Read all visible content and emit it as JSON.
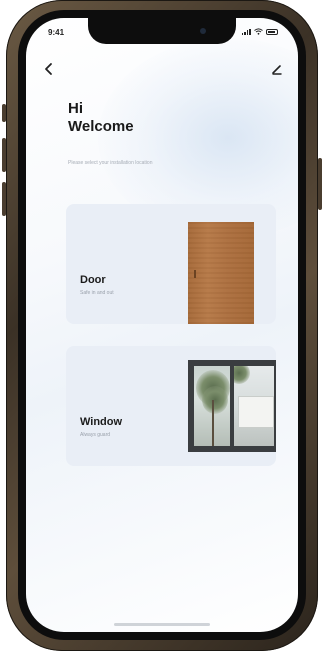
{
  "status_bar": {
    "time": "9:41"
  },
  "header": {
    "back_icon": "chevron-left-icon",
    "edit_icon": "edit-icon"
  },
  "greeting": {
    "hi": "Hi",
    "welcome": "Welcome",
    "subtitle": "Please select your installation location"
  },
  "cards": [
    {
      "title": "Door",
      "subtitle": "Safe in and out",
      "image": "wooden-door-image"
    },
    {
      "title": "Window",
      "subtitle": "Always guard",
      "image": "window-image"
    }
  ],
  "colors": {
    "card_background": "#e9eef6",
    "title_text": "#1b1b1b",
    "muted_text": "#9aa1ab",
    "frame_gold": "#5e4e3b"
  }
}
